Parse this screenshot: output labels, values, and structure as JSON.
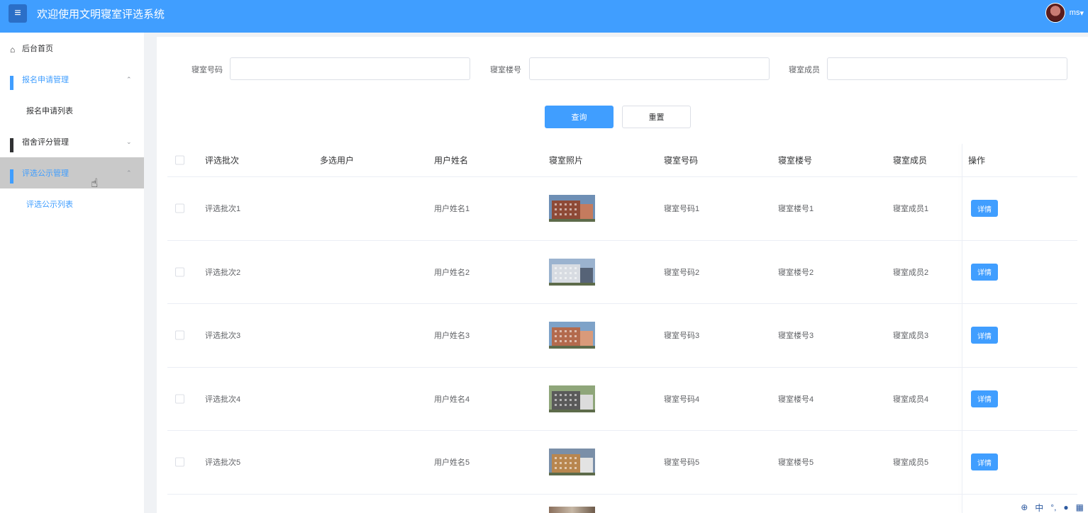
{
  "header": {
    "menu_icon": "menu-icon",
    "title": "欢迎使用文明寝室评选系统",
    "user_name": "ms",
    "user_caret": "▾"
  },
  "sidebar": {
    "items": [
      {
        "label": "后台首页",
        "icon": "home-icon"
      },
      {
        "label": "报名申请管理",
        "icon": "grid-icon",
        "arrow": "⌃"
      },
      {
        "label": "报名申请列表"
      },
      {
        "label": "宿舍评分管理",
        "icon": "grid-icon",
        "arrow": "⌄"
      },
      {
        "label": "评选公示管理",
        "icon": "grid-icon",
        "arrow": "⌃"
      },
      {
        "label": "评选公示列表"
      }
    ]
  },
  "filters": {
    "room_number_label": "寝室号码",
    "building_label": "寝室楼号",
    "members_label": "寝室成员",
    "query_button": "查询",
    "reset_button": "重置"
  },
  "table": {
    "columns": [
      "评选批次",
      "多选用户",
      "用户姓名",
      "寝室照片",
      "寝室号码",
      "寝室楼号",
      "寝室成员",
      "操作"
    ],
    "rows": [
      {
        "batch": "评选批次1",
        "user": "",
        "name": "用户姓名1",
        "room": "寝室号码1",
        "building": "寝室楼号1",
        "members": "寝室成员1",
        "action": "详情"
      },
      {
        "batch": "评选批次2",
        "user": "",
        "name": "用户姓名2",
        "room": "寝室号码2",
        "building": "寝室楼号2",
        "members": "寝室成员2",
        "action": "详情"
      },
      {
        "batch": "评选批次3",
        "user": "",
        "name": "用户姓名3",
        "room": "寝室号码3",
        "building": "寝室楼号3",
        "members": "寝室成员3",
        "action": "详情"
      },
      {
        "batch": "评选批次4",
        "user": "",
        "name": "用户姓名4",
        "room": "寝室号码4",
        "building": "寝室楼号4",
        "members": "寝室成员4",
        "action": "详情"
      },
      {
        "batch": "评选批次5",
        "user": "",
        "name": "用户姓名5",
        "room": "寝室号码5",
        "building": "寝室楼号5",
        "members": "寝室成员5",
        "action": "详情"
      }
    ]
  },
  "tray": {
    "ime_label": "中",
    "icons": [
      "ime-icon",
      "punctuation-icon",
      "mic-icon",
      "apps-icon"
    ]
  },
  "colors": {
    "primary": "#409eff",
    "sidebar_active_bg": "#c9c9c9"
  }
}
